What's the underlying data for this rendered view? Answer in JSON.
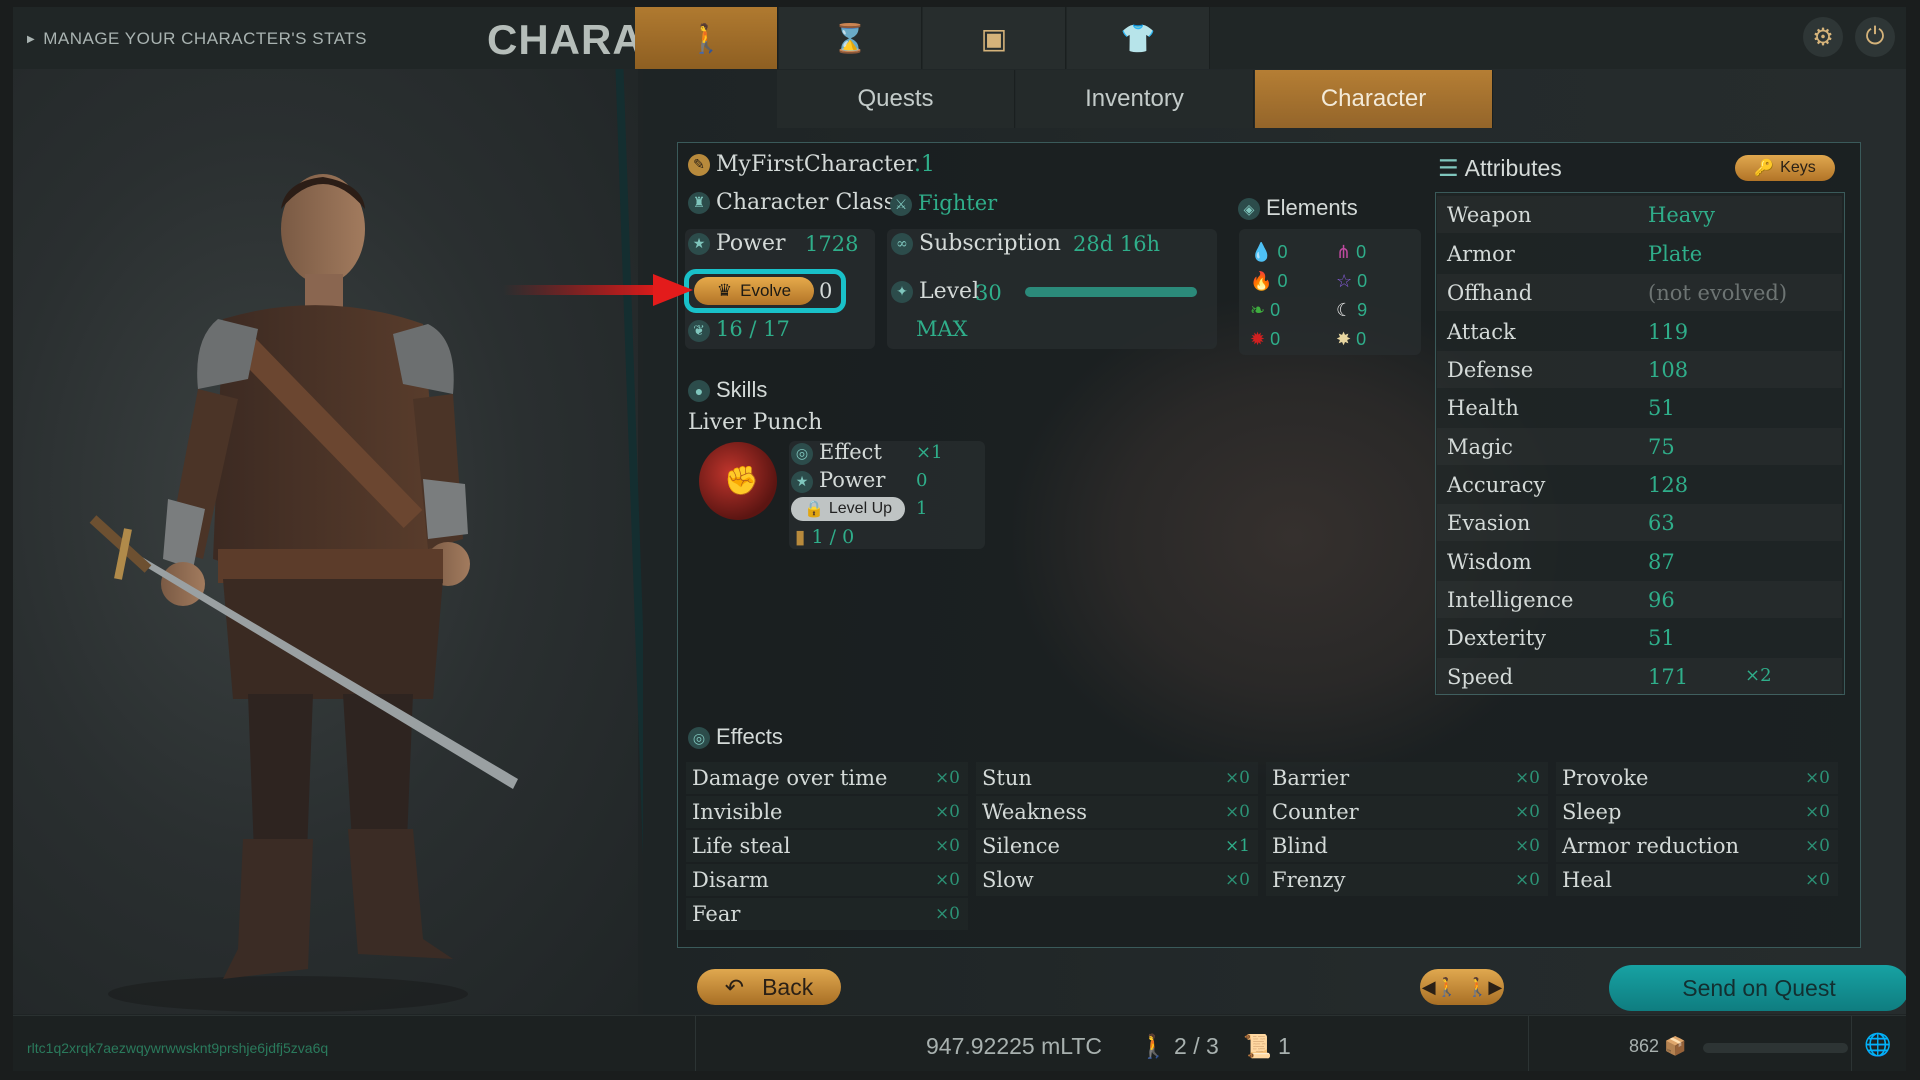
{
  "header": {
    "subtitle": "MANAGE YOUR CHARACTER'S STATS",
    "title": "CHARACTER",
    "icon_tabs": [
      "person-icon",
      "hourglass-icon",
      "chest-icon",
      "shirt-icon"
    ],
    "active_icon_tab": 0
  },
  "tabs": [
    {
      "label": "Quests"
    },
    {
      "label": "Inventory"
    },
    {
      "label": "Character",
      "active": true
    }
  ],
  "character": {
    "name": "MyFirstCharacter",
    "name_suffix": ".1",
    "class_label": "Character Class",
    "class_value": "Fighter",
    "power_label": "Power",
    "power_value": "1728",
    "subscription_label": "Subscription",
    "subscription_value": "28d 16h",
    "evolve_label": "Evolve",
    "evolve_count": "0",
    "level_label": "Level",
    "level_value": "30",
    "level_max": "MAX",
    "level_progress": 1.0,
    "feathers": "16 / 17"
  },
  "elements": {
    "title": "Elements",
    "items": [
      {
        "icon": "water-drop-icon",
        "value": "0"
      },
      {
        "icon": "claw-icon",
        "value": "0"
      },
      {
        "icon": "fire-icon",
        "value": "0"
      },
      {
        "icon": "star-outline-icon",
        "value": "0"
      },
      {
        "icon": "leaf-icon",
        "value": "0"
      },
      {
        "icon": "moon-icon",
        "value": "9"
      },
      {
        "icon": "blood-icon",
        "value": "0"
      },
      {
        "icon": "sun-icon",
        "value": "0"
      }
    ]
  },
  "skills": {
    "title": "Skills",
    "skill_name": "Liver Punch",
    "effect_label": "Effect",
    "effect_value": "×1",
    "power_label": "Power",
    "power_value": "0",
    "level_up_label": "Level Up",
    "level_up_value": "1",
    "scrolls": "1 / 0"
  },
  "attributes": {
    "title": "Attributes",
    "keys_label": "Keys",
    "rows": [
      {
        "name": "Weapon",
        "value": "Heavy"
      },
      {
        "name": "Armor",
        "value": "Plate"
      },
      {
        "name": "Offhand",
        "value": "(not evolved)"
      },
      {
        "name": "Attack",
        "value": "119"
      },
      {
        "name": "Defense",
        "value": "108"
      },
      {
        "name": "Health",
        "value": "51"
      },
      {
        "name": "Magic",
        "value": "75"
      },
      {
        "name": "Accuracy",
        "value": "128"
      },
      {
        "name": "Evasion",
        "value": "63"
      },
      {
        "name": "Wisdom",
        "value": "87"
      },
      {
        "name": "Intelligence",
        "value": "96"
      },
      {
        "name": "Dexterity",
        "value": "51"
      },
      {
        "name": "Speed",
        "value": "171",
        "extra": "×2"
      }
    ]
  },
  "effects": {
    "title": "Effects",
    "items": [
      {
        "name": "Damage over time",
        "count": "×0"
      },
      {
        "name": "Invisible",
        "count": "×0"
      },
      {
        "name": "Life steal",
        "count": "×0"
      },
      {
        "name": "Disarm",
        "count": "×0"
      },
      {
        "name": "Fear",
        "count": "×0"
      },
      {
        "name": "Stun",
        "count": "×0"
      },
      {
        "name": "Weakness",
        "count": "×0"
      },
      {
        "name": "Silence",
        "count": "×1"
      },
      {
        "name": "Slow",
        "count": "×0"
      },
      {
        "name": "Barrier",
        "count": "×0"
      },
      {
        "name": "Counter",
        "count": "×0"
      },
      {
        "name": "Blind",
        "count": "×0"
      },
      {
        "name": "Frenzy",
        "count": "×0"
      },
      {
        "name": "Provoke",
        "count": "×0"
      },
      {
        "name": "Sleep",
        "count": "×0"
      },
      {
        "name": "Armor reduction",
        "count": "×0"
      },
      {
        "name": "Heal",
        "count": "×0"
      }
    ]
  },
  "buttons": {
    "back": "Back",
    "send": "Send on Quest"
  },
  "footer": {
    "wallet": "rltc1q2xrqk7aezwqywrwwsknt9prshje6jdfj5zva6q",
    "balance": "947.92225 mLTC",
    "party": "2 / 3",
    "quests": "1",
    "storage": "862",
    "storage_fill": 0.0
  },
  "colors": {
    "accent_gold": "#c68a3a",
    "accent_teal": "#19c1c9",
    "value_green": "#2fae8a"
  }
}
